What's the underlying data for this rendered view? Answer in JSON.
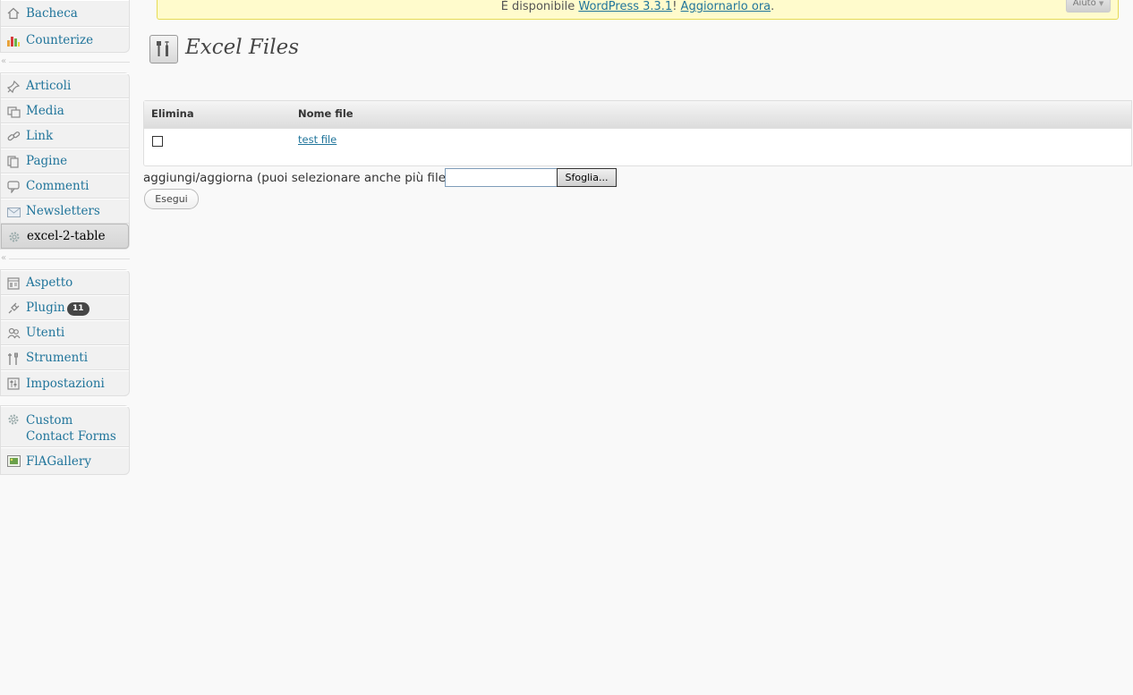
{
  "sidebar": {
    "group1": [
      {
        "label": "Bacheca",
        "icon": "dashboard-icon"
      },
      {
        "label": "Counterize",
        "icon": "bar-chart-icon"
      }
    ],
    "group2": [
      {
        "label": "Articoli",
        "icon": "pushpin-icon"
      },
      {
        "label": "Media",
        "icon": "media-icon"
      },
      {
        "label": "Link",
        "icon": "link-icon"
      },
      {
        "label": "Pagine",
        "icon": "pages-icon"
      },
      {
        "label": "Commenti",
        "icon": "comment-icon"
      },
      {
        "label": "Newsletters",
        "icon": "envelope-icon"
      },
      {
        "label": "excel-2-table",
        "icon": "gear-icon",
        "active": true
      }
    ],
    "group3": [
      {
        "label": "Aspetto",
        "icon": "appearance-icon"
      },
      {
        "label": "Plugin",
        "icon": "plugin-icon",
        "badge": "11"
      },
      {
        "label": "Utenti",
        "icon": "users-icon"
      },
      {
        "label": "Strumenti",
        "icon": "tools-icon"
      },
      {
        "label": "Impostazioni",
        "icon": "settings-icon"
      }
    ],
    "group4": [
      {
        "label": "Custom Contact Forms",
        "line1": "Custom",
        "line2": "Contact Forms",
        "icon": "gear-icon"
      },
      {
        "label": "FlAGallery",
        "icon": "gallery-icon"
      }
    ]
  },
  "notice": {
    "prefix": "È disponibile ",
    "link1": "WordPress 3.3.1",
    "middle": "! ",
    "link2": "Aggiornarlo ora",
    "suffix": ".",
    "help_label": "Aiuto"
  },
  "page": {
    "title": "Excel Files"
  },
  "table": {
    "headers": [
      "Elimina",
      "Nome file"
    ],
    "rows": [
      {
        "checked": false,
        "file_name": "test file"
      }
    ]
  },
  "upload": {
    "label": "aggiungi/aggiorna (puoi selezionare anche più file)",
    "browse_label": "Sfoglia...",
    "submit_label": "Esegui"
  },
  "colors": {
    "link": "#21759b",
    "notice_bg": "#fffbcc",
    "badge_bg": "#464646"
  }
}
